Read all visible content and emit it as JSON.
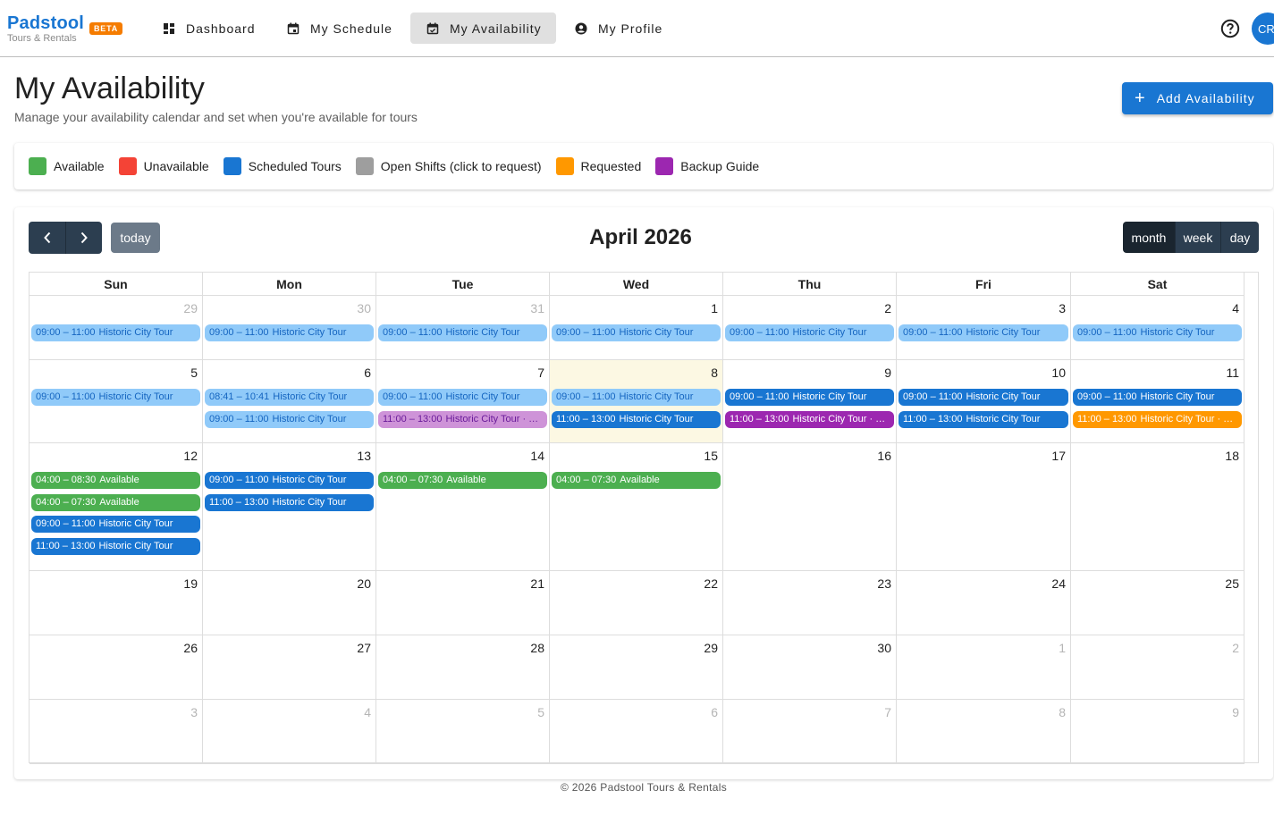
{
  "app": {
    "brand": "Padstool",
    "brand_sub": "Tours & Rentals",
    "beta": "BETA",
    "avatar": "CR"
  },
  "nav": [
    {
      "label": "Dashboard",
      "icon": "dashboard-icon"
    },
    {
      "label": "My Schedule",
      "icon": "calendar-icon"
    },
    {
      "label": "My Availability",
      "icon": "calendar-check-icon",
      "active": true
    },
    {
      "label": "My Profile",
      "icon": "account-circle-icon"
    }
  ],
  "page": {
    "title": "My Availability",
    "subtitle": "Manage your availability calendar and set when you're available for tours",
    "add_button": "Add Availability"
  },
  "legend": [
    {
      "label": "Available",
      "color": "#4caf50"
    },
    {
      "label": "Unavailable",
      "color": "#f44336"
    },
    {
      "label": "Scheduled Tours",
      "color": "#1976d2"
    },
    {
      "label": "Open Shifts (click to request)",
      "color": "#9e9e9e"
    },
    {
      "label": "Requested",
      "color": "#ff9800"
    },
    {
      "label": "Backup Guide",
      "color": "#9c27b0"
    }
  ],
  "calendar": {
    "title": "April 2026",
    "prev": "‹",
    "next": "›",
    "today": "today",
    "views": [
      "month",
      "week",
      "day"
    ],
    "active_view": "month",
    "weekdays": [
      "Sun",
      "Mon",
      "Tue",
      "Wed",
      "Thu",
      "Fri",
      "Sat"
    ],
    "weeks": [
      [
        {
          "day": "29",
          "other": true,
          "events": [
            {
              "time": "09:00 – 11:00",
              "title": "Historic City Tour",
              "kind": "open"
            }
          ]
        },
        {
          "day": "30",
          "other": true,
          "events": [
            {
              "time": "09:00 – 11:00",
              "title": "Historic City Tour",
              "kind": "open"
            }
          ]
        },
        {
          "day": "31",
          "other": true,
          "events": [
            {
              "time": "09:00 – 11:00",
              "title": "Historic City Tour",
              "kind": "open"
            }
          ]
        },
        {
          "day": "1",
          "events": [
            {
              "time": "09:00 – 11:00",
              "title": "Historic City Tour",
              "kind": "open"
            }
          ]
        },
        {
          "day": "2",
          "events": [
            {
              "time": "09:00 – 11:00",
              "title": "Historic City Tour",
              "kind": "open"
            }
          ]
        },
        {
          "day": "3",
          "events": [
            {
              "time": "09:00 – 11:00",
              "title": "Historic City Tour",
              "kind": "open"
            }
          ]
        },
        {
          "day": "4",
          "events": [
            {
              "time": "09:00 – 11:00",
              "title": "Historic City Tour",
              "kind": "open"
            }
          ]
        }
      ],
      [
        {
          "day": "5",
          "events": [
            {
              "time": "09:00 – 11:00",
              "title": "Historic City Tour",
              "kind": "open"
            }
          ]
        },
        {
          "day": "6",
          "events": [
            {
              "time": "08:41 – 10:41",
              "title": "Historic City Tour",
              "kind": "open"
            },
            {
              "time": "09:00 – 11:00",
              "title": "Historic City Tour",
              "kind": "open"
            }
          ]
        },
        {
          "day": "7",
          "events": [
            {
              "time": "09:00 – 11:00",
              "title": "Historic City Tour",
              "kind": "open"
            },
            {
              "time": "11:00 – 13:00",
              "title": "Historic City Tour · …",
              "kind": "backup-light"
            }
          ]
        },
        {
          "day": "8",
          "today": true,
          "events": [
            {
              "time": "09:00 – 11:00",
              "title": "Historic City Tour",
              "kind": "open"
            },
            {
              "time": "11:00 – 13:00",
              "title": "Historic City Tour",
              "kind": "scheduled"
            }
          ]
        },
        {
          "day": "9",
          "events": [
            {
              "time": "09:00 – 11:00",
              "title": "Historic City Tour",
              "kind": "scheduled"
            },
            {
              "time": "11:00 – 13:00",
              "title": "Historic City Tour · …",
              "kind": "backup"
            }
          ]
        },
        {
          "day": "10",
          "events": [
            {
              "time": "09:00 – 11:00",
              "title": "Historic City Tour",
              "kind": "scheduled"
            },
            {
              "time": "11:00 – 13:00",
              "title": "Historic City Tour",
              "kind": "scheduled"
            }
          ]
        },
        {
          "day": "11",
          "events": [
            {
              "time": "09:00 – 11:00",
              "title": "Historic City Tour",
              "kind": "scheduled"
            },
            {
              "time": "11:00 – 13:00",
              "title": "Historic City Tour · …",
              "kind": "requested"
            }
          ]
        }
      ],
      [
        {
          "day": "12",
          "events": [
            {
              "time": "04:00 – 08:30",
              "title": "Available",
              "kind": "available"
            },
            {
              "time": "04:00 – 07:30",
              "title": "Available",
              "kind": "available"
            },
            {
              "time": "09:00 – 11:00",
              "title": "Historic City Tour",
              "kind": "scheduled"
            },
            {
              "time": "11:00 – 13:00",
              "title": "Historic City Tour",
              "kind": "scheduled"
            }
          ]
        },
        {
          "day": "13",
          "events": [
            {
              "time": "09:00 – 11:00",
              "title": "Historic City Tour",
              "kind": "scheduled"
            },
            {
              "time": "11:00 – 13:00",
              "title": "Historic City Tour",
              "kind": "scheduled"
            }
          ]
        },
        {
          "day": "14",
          "events": [
            {
              "time": "04:00 – 07:30",
              "title": "Available",
              "kind": "available"
            }
          ]
        },
        {
          "day": "15",
          "events": [
            {
              "time": "04:00 – 07:30",
              "title": "Available",
              "kind": "available"
            }
          ]
        },
        {
          "day": "16",
          "events": []
        },
        {
          "day": "17",
          "events": []
        },
        {
          "day": "18",
          "events": []
        }
      ],
      [
        {
          "day": "19",
          "events": []
        },
        {
          "day": "20",
          "events": []
        },
        {
          "day": "21",
          "events": []
        },
        {
          "day": "22",
          "events": []
        },
        {
          "day": "23",
          "events": []
        },
        {
          "day": "24",
          "events": []
        },
        {
          "day": "25",
          "events": []
        }
      ],
      [
        {
          "day": "26",
          "events": []
        },
        {
          "day": "27",
          "events": []
        },
        {
          "day": "28",
          "events": []
        },
        {
          "day": "29",
          "events": []
        },
        {
          "day": "30",
          "events": []
        },
        {
          "day": "1",
          "other": true,
          "events": []
        },
        {
          "day": "2",
          "other": true,
          "events": []
        }
      ],
      [
        {
          "day": "3",
          "other": true,
          "events": []
        },
        {
          "day": "4",
          "other": true,
          "events": []
        },
        {
          "day": "5",
          "other": true,
          "events": []
        },
        {
          "day": "6",
          "other": true,
          "events": []
        },
        {
          "day": "7",
          "other": true,
          "events": []
        },
        {
          "day": "8",
          "other": true,
          "events": []
        },
        {
          "day": "9",
          "other": true,
          "events": []
        }
      ]
    ]
  },
  "event_styles": {
    "open": {
      "bg": "#90caf9",
      "fg": "#1565c0"
    },
    "scheduled": {
      "bg": "#1976d2",
      "fg": "#ffffff"
    },
    "available": {
      "bg": "#4caf50",
      "fg": "#ffffff"
    },
    "backup": {
      "bg": "#9c27b0",
      "fg": "#ffffff"
    },
    "backup-light": {
      "bg": "#ce93d8",
      "fg": "#6a1b9a"
    },
    "requested": {
      "bg": "#ff9800",
      "fg": "#ffffff"
    }
  },
  "footer": "© 2026 Padstool Tours & Rentals"
}
